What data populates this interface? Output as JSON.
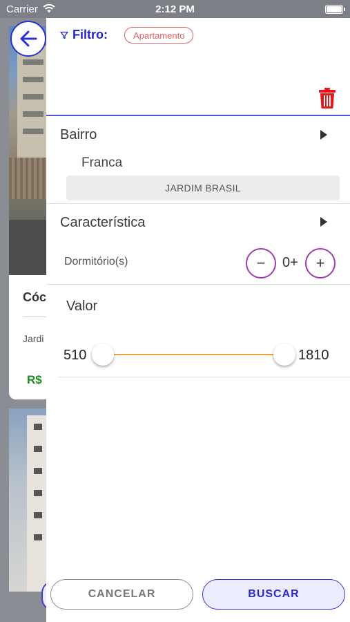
{
  "status_bar": {
    "carrier": "Carrier",
    "time": "2:12 PM",
    "battery_level": 1.0
  },
  "background_list": {
    "card_code_partial": "Cóc",
    "card_bairro_partial": "Jardi",
    "card_price_partial": "R$"
  },
  "drawer": {
    "filter": {
      "label": "Filtro:",
      "chip": "Apartamento",
      "filter_icon": "filter-funnel-icon",
      "clear_icon": "trash-icon",
      "clear_icon_color": "#e8161b"
    },
    "bairro": {
      "title": "Bairro",
      "city": "Franca",
      "neighborhood": "JARDIM BRASIL"
    },
    "caracteristica": {
      "title": "Característica",
      "dormitorio_label": "Dormitório(s)",
      "dormitorio_value": "0+",
      "minus_symbol": "−",
      "plus_symbol": "+"
    },
    "valor": {
      "title": "Valor",
      "min": "510",
      "max": "1810",
      "track_color": "#f0a33a"
    },
    "actions": {
      "cancel": "CANCELAR",
      "search": "BUSCAR"
    }
  },
  "colors": {
    "accent": "#2a2ad0",
    "chip_red": "#e26060",
    "stepper_purple": "#a03ab0",
    "price_green": "#1b8a1b"
  }
}
